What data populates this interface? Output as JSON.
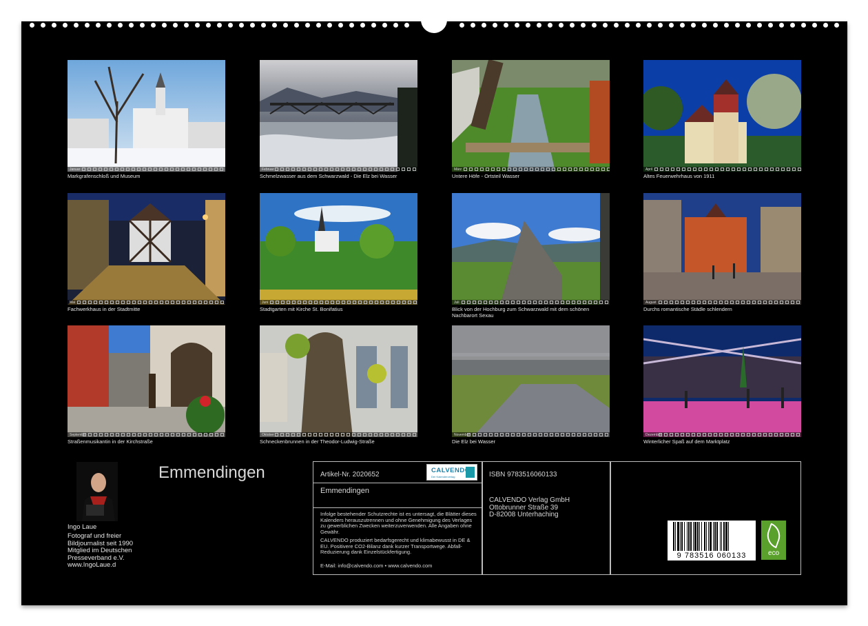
{
  "calendar": {
    "title": "Emmendingen",
    "months": [
      {
        "label": "Januar",
        "caption": "Markgrafenschloß und Museum",
        "icon": "winter-castle-photo"
      },
      {
        "label": "Februar",
        "caption": "Schmelzwasser aus dem Schwarzwald - Die Elz bei Wasser",
        "icon": "river-bridge-photo"
      },
      {
        "label": "März",
        "caption": "Untere Höfe - Ortsteil Wasser",
        "icon": "stream-path-photo"
      },
      {
        "label": "April",
        "caption": "Altes Feuerwehrhaus von 1911",
        "icon": "firehouse-photo"
      },
      {
        "label": "Mai",
        "caption": "Fachwerkhaus in der Stadtmitte",
        "icon": "half-timbered-house-photo"
      },
      {
        "label": "Juni",
        "caption": "Stadtgarten mit Kirche St. Bonifatius",
        "icon": "garden-church-photo"
      },
      {
        "label": "Juli",
        "caption": "Blick von der Hochburg zum Schwarzwald mit dem schönen Nachbarort Sexau",
        "icon": "castle-ruin-photo"
      },
      {
        "label": "August",
        "caption": "Durchs romantische Städle schlendern",
        "icon": "town-gate-evening-photo"
      },
      {
        "label": "September",
        "caption": "Straßenmusikantin in der Kirchstraße",
        "icon": "street-musician-photo"
      },
      {
        "label": "Oktober",
        "caption": "Schneckenbrunnen in der Theodor-Ludwig-Straße",
        "icon": "fountain-statue-photo"
      },
      {
        "label": "November",
        "caption": "Die Elz bei Wasser",
        "icon": "river-fog-photo"
      },
      {
        "label": "Dezember",
        "caption": "Winterlicher Spaß auf dem Marktplatz",
        "icon": "ice-rink-photo"
      }
    ]
  },
  "author": {
    "name": "Ingo Laue",
    "bio": [
      "Fotograf und freier",
      "Bildjournalist seit 1990",
      "Mitglied im Deutschen",
      "Presseverband e.V.",
      "www.IngoLaue.d"
    ],
    "icon": "photographer-portrait"
  },
  "info": {
    "article": "Artikel-Nr. 2020652",
    "product_title": "Emmendingen",
    "legal": "Infolge bestehender Schutzrechte ist es untersagt, die Blätter dieses Kalenders herauszutrennen und ohne Genehmigung des Verlages zu gewerblichen Zwecken weiterzuverwenden. Alle Angaben ohne Gewähr.",
    "climate": "CALVENDO produziert bedarfsgerecht und klimabewusst in DE & EU. Positivere CO2-Bilanz dank kurzer Transportwege. Abfall-Reduzierung dank Einzelstückfertigung.",
    "contact": "E-Mail: info@calvendo.com • www.calvendo.com",
    "isbn": "ISBN 9783516060133",
    "publisher": [
      "CALVENDO Verlag GmbH",
      "Ottobrunner Straße 39",
      "D-82008 Unterhaching"
    ],
    "logo_text": "CALVENDO",
    "logo_sub": "Der Kalenderverlag",
    "barcode_number": "9 783516 060133",
    "eco_label": "eco"
  },
  "colors": {
    "background": "#000000",
    "text": "#e8e8e8",
    "border": "#bdbdbd",
    "eco_green": "#5aa02c",
    "calvendo_blue": "#1a7fa8"
  }
}
